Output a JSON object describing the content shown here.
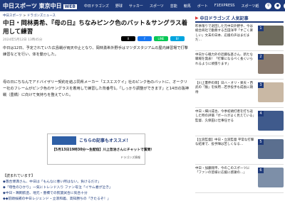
{
  "header": {
    "logo": "中日スポーツ 東京中日",
    "logo_badge": "WEB",
    "nav": [
      "中日ドラゴンズ",
      "野球",
      "サッカー",
      "スポーツ",
      "芸能",
      "競馬",
      "ボート",
      "F1EXPRESS",
      "スポーツ紙"
    ],
    "icons": [
      "search-icon",
      "user-icon",
      "menu-icon"
    ]
  },
  "breadcrumb": {
    "home": "中日スポーツ",
    "sep": " > ",
    "section": "ドラゴンズニュース"
  },
  "article": {
    "title": "中日・岡林勇希、『母の日』ちなみピンク色のバット＆サングラス着用して練習",
    "meta": "2024年5月12日 13時45分",
    "share": [
      {
        "label": "X",
        "color": "#000000"
      },
      {
        "label": "f",
        "color": "#1877f2"
      },
      {
        "label": "LINE",
        "color": "#06c755"
      },
      {
        "label": "B!",
        "color": "#00a4de"
      }
    ],
    "paragraphs": [
      "中日は12日、予定されていた広島戦が雨天中止となり、岡林勇希外野手はマツダスタジアムの屋内練習場で打撃練習などを行い、体を動かした。",
      "母の日にちなんでアドバイザリー契約を結ぶ同県メーカー「エスエスケイ」社のピンク色のバットに、オークリー社のフレームがピンク色のサングラスを着用して練習した背番号1。「しっかり調整ができます」と14日の阪神戦（豊橋）に向けて気持ちを整えていた。"
    ]
  },
  "ad": {
    "title": "こちらの記事もオススメ！",
    "subtitle": "【5月13日19時30分～生配信】川上哲治さんにチャットで質問！",
    "brand": "ドラゴンズ情報"
  },
  "related": {
    "heading": "【読まれています】",
    "items": [
      "◆落合博満さん、中日は「もんなに悪い所はない。負けるだけ」",
      "◆「母性のひかり」一気にトレンド入り ファン号泣「イサム君が泣き」",
      "◆中日・鵜飼航丞、地元・豊橋での凱旋試合に気合十分",
      "◆◆前頭候補の中日レジェンド・立浪和義、高知勝ちの「きたるぞ！」"
    ]
  },
  "sidebar": {
    "ranking_title": "中日ドラゴンズ 人気記事",
    "items": [
      {
        "num": "1",
        "text": "昨季限りで退団した元中日外野手、今は総合商社で勤務する吉田洋平「すごく楽しい」文末の日本、応援の声はまだまだ…",
        "thumb_color": "#6d6a5c"
      },
      {
        "num": "2",
        "text": "中日から戦力外の近藤弘基さん、新たな職場を発表！「打撃になるべく長くいられるように頑張ります」",
        "thumb_color": "#8a7b6e"
      },
      {
        "num": "3",
        "text": "【川上憲伸の目】日ハ・オリ・楽天・西武の「脈」を採用…若手投手も成長に期待",
        "thumb_color": "#c9b8a4"
      },
      {
        "num": "4",
        "text": "中日・細川成也、今季初頭打者を打ち返した時の評価「ボールがよく見えている」監督、久保田に仕事任せる",
        "thumb_color": "#3f5a8c"
      },
      {
        "num": "5",
        "text": "【立浪監督】中日・立浪監督 平常な打撃な結果で、投手陣は苦しくなる…",
        "thumb_color": "#5b6f8f"
      },
      {
        "num": "6",
        "text": "中日・加藤翔平、今のこのスポーツに「ファンの皆様に応援に感謝の…」",
        "thumb_color": "#7d8fa8"
      }
    ]
  }
}
